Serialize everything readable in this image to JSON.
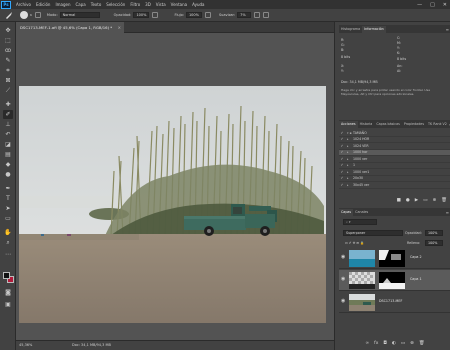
{
  "app": {
    "logo": "Ps"
  },
  "menu": [
    "Archivo",
    "Edición",
    "Imagen",
    "Capa",
    "Texto",
    "Selección",
    "Filtro",
    "3D",
    "Vista",
    "Ventana",
    "Ayuda"
  ],
  "window_controls": {
    "minimize": "—",
    "maximize": "□",
    "close": "✕"
  },
  "options_bar": {
    "tool_icon": "brush-icon",
    "brush_size": "6",
    "mode_label": "Modo:",
    "mode_value": "Normal",
    "opacity_label": "Opacidad:",
    "opacity_value": "100%",
    "flow_label": "Flujo:",
    "flow_value": "100%",
    "smoothing_label": "Suavizar:",
    "smoothing_value": "7%"
  },
  "document_tab": {
    "title": "DSC1713-MEF-1.afi @ 45,6% (Capa 1, RGB/16) *",
    "close": "×"
  },
  "status_bar": {
    "zoom": "45,36%",
    "doc_info": "Doc: 34,1 MB/94,3 MB"
  },
  "info_panel": {
    "tabs": [
      "Histograma",
      "Información"
    ],
    "active_tab": 1,
    "r_label": "R:",
    "g_label": "G:",
    "b_label": "B:",
    "c_label": "C:",
    "m_label": "M:",
    "y_label": "Y:",
    "k_label": "K:",
    "bit_left": "8 bits",
    "bit_right": "8 bits",
    "x_label": "X:",
    "y2_label": "Y:",
    "w_label": "An:",
    "h_label": "Al:",
    "doc_line": "Doc: 34,1 MB/94,3 MB",
    "hint": "Haga clic y arrastre para pintar usando el color frontal. Use Mayúsculas, Alt y Ctrl para opciones adicionales."
  },
  "actions_panel": {
    "tabs": [
      "Acciones",
      "Historia",
      "Capas básicas",
      "Propiedades",
      "TK Rank V2"
    ],
    "active_tab": 0,
    "rows": [
      {
        "label": "TAMAÑO",
        "check": "✓",
        "selected": false
      },
      {
        "label": "1024 HOR",
        "check": "✓",
        "selected": false
      },
      {
        "label": "1024 VER",
        "check": "✓",
        "selected": false
      },
      {
        "label": "1000 hor",
        "check": "✓",
        "selected": true
      },
      {
        "label": "1000 ver",
        "check": "✓",
        "selected": false
      },
      {
        "label": "1",
        "check": "✓",
        "selected": false
      },
      {
        "label": "1000 ver1",
        "check": "✓",
        "selected": false
      },
      {
        "label": "20x30",
        "check": "✓",
        "selected": false
      },
      {
        "label": "30x45 ver",
        "check": "✓",
        "selected": false
      }
    ]
  },
  "layers_panel": {
    "tabs": [
      "Capas",
      "Canales"
    ],
    "active_tab": 0,
    "blend_mode": "Superponer",
    "opacity_label": "Opacidad:",
    "opacity_value": "100%",
    "fill_label": "Relleno:",
    "fill_value": "100%",
    "layers": [
      {
        "name": "Capa 2",
        "selected": false,
        "thumb": "sky"
      },
      {
        "name": "Capa 1",
        "selected": true,
        "thumb": "checker"
      },
      {
        "name": "DSC1713-MEF",
        "selected": false,
        "thumb": "photo"
      }
    ]
  },
  "colors": {
    "foreground": "#111111",
    "background": "#b01a3a",
    "accent": "#31a8ff"
  }
}
